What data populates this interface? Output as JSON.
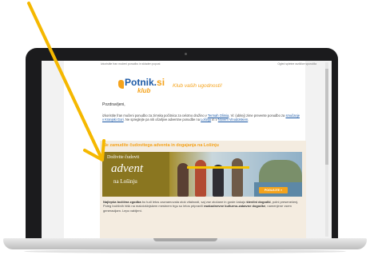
{
  "email": {
    "top_left": "Izkoristite fran mučeni ponudbo in skladen popust",
    "top_right": "Ogled spletne različice sporočila",
    "logo_text": "Potnik.",
    "logo_suffix": "si",
    "logo_klub": "klub",
    "tagline": "Klub vaših ugodnosti!",
    "greeting": "Pozdravljeni,",
    "p1_a": "izkoristite fran mučeni ponudbo za zimska počitnica za celotno družino v ",
    "link1": "Termah Olimia",
    "p1_b": ". Vi: (ubitej) zime prevente ponudbo za ",
    "link2": "smučanje v Kranjski Gori",
    "p1_c": ". Ne spreglejte pa niti očarljive adventne ponudbe na ",
    "link3": "Lošinju",
    "p1_d": " in v ",
    "link4": "Novem Vinodolskem",
    "p1_e": ".",
    "section_title": "Ne zamudite čudovitega adventa in dogajanja na Lošinju",
    "banner_line1": "Doživite čudovit",
    "banner_line2": "advent",
    "banner_line3": "na Lošinju",
    "cta": "POGLEJTE »",
    "body_bold1": "Najlepša božična zgodba",
    "body_a": " bo tudi letos zaznamovala otok vitalnosti, saj vse otočane in goste čakajo ",
    "body_bold2": "številni dogodki",
    "body_b": ", polni presenečenj. Poleg božičnih hišk na malološinjskem mestnem trgu so letos pripravili ",
    "body_bold3": "vsakodnevne kulturno-zabavne dogodke",
    "body_c": ", namenjene vsem generacijam. Lepo vabljeni."
  },
  "colors": {
    "accent": "#f5a31c",
    "brand_blue": "#1d5aa6",
    "arrow": "#f5b800"
  }
}
